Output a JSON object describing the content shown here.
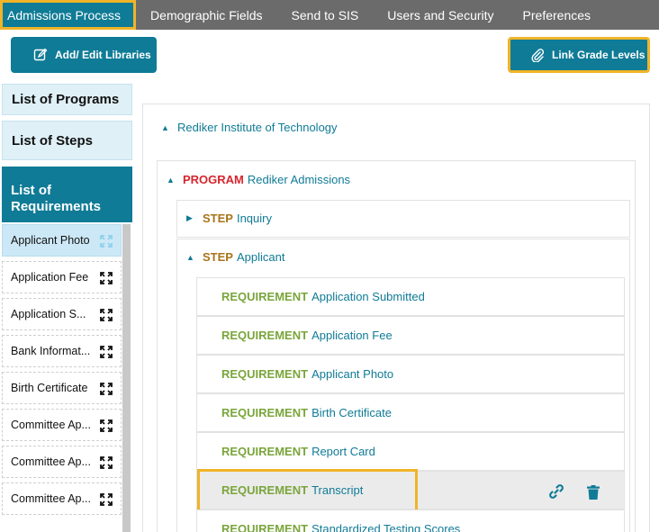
{
  "topnav": {
    "tabs": [
      {
        "label": "Admissions Process",
        "active": true
      },
      {
        "label": "Demographic Fields"
      },
      {
        "label": "Send to SIS"
      },
      {
        "label": "Users and Security"
      },
      {
        "label": "Preferences"
      }
    ]
  },
  "toolbar": {
    "add_edit_label": "Add/ Edit Libraries",
    "link_grade_label": "Link Grade Levels"
  },
  "left": {
    "list_programs": "List of Programs",
    "list_steps": "List of Steps",
    "list_requirements": "List of Requirements",
    "requirements": [
      {
        "name": "Applicant Photo",
        "selected": true
      },
      {
        "name": "Application Fee"
      },
      {
        "name": "Application S..."
      },
      {
        "name": "Bank Informat..."
      },
      {
        "name": "Birth Certificate"
      },
      {
        "name": "Committee Ap..."
      },
      {
        "name": "Committee Ap..."
      },
      {
        "name": "Committee Ap..."
      }
    ]
  },
  "tree": {
    "school": "Rediker Institute of Technology",
    "program_keyword": "PROGRAM",
    "program_name": "Rediker Admissions",
    "step_keyword": "STEP",
    "steps": [
      {
        "name": "Inquiry",
        "expanded": false
      },
      {
        "name": "Applicant",
        "expanded": true
      }
    ],
    "requirement_keyword": "REQUIREMENT",
    "requirements": [
      {
        "name": "Application Submitted"
      },
      {
        "name": "Application Fee"
      },
      {
        "name": "Applicant Photo"
      },
      {
        "name": "Birth Certificate"
      },
      {
        "name": "Report Card"
      },
      {
        "name": "Transcript",
        "highlighted": true
      },
      {
        "name": "Standardized Testing Scores"
      }
    ]
  },
  "colors": {
    "accent": "#0f7b96",
    "highlight": "#f0b429",
    "program": "#d6252d",
    "step": "#a8741a",
    "requirement": "#7aa53b"
  },
  "icons": {
    "edit": "edit-icon",
    "paperclip": "paperclip-icon",
    "expand": "expand-icon",
    "link": "link-icon",
    "trash": "trash-icon"
  }
}
